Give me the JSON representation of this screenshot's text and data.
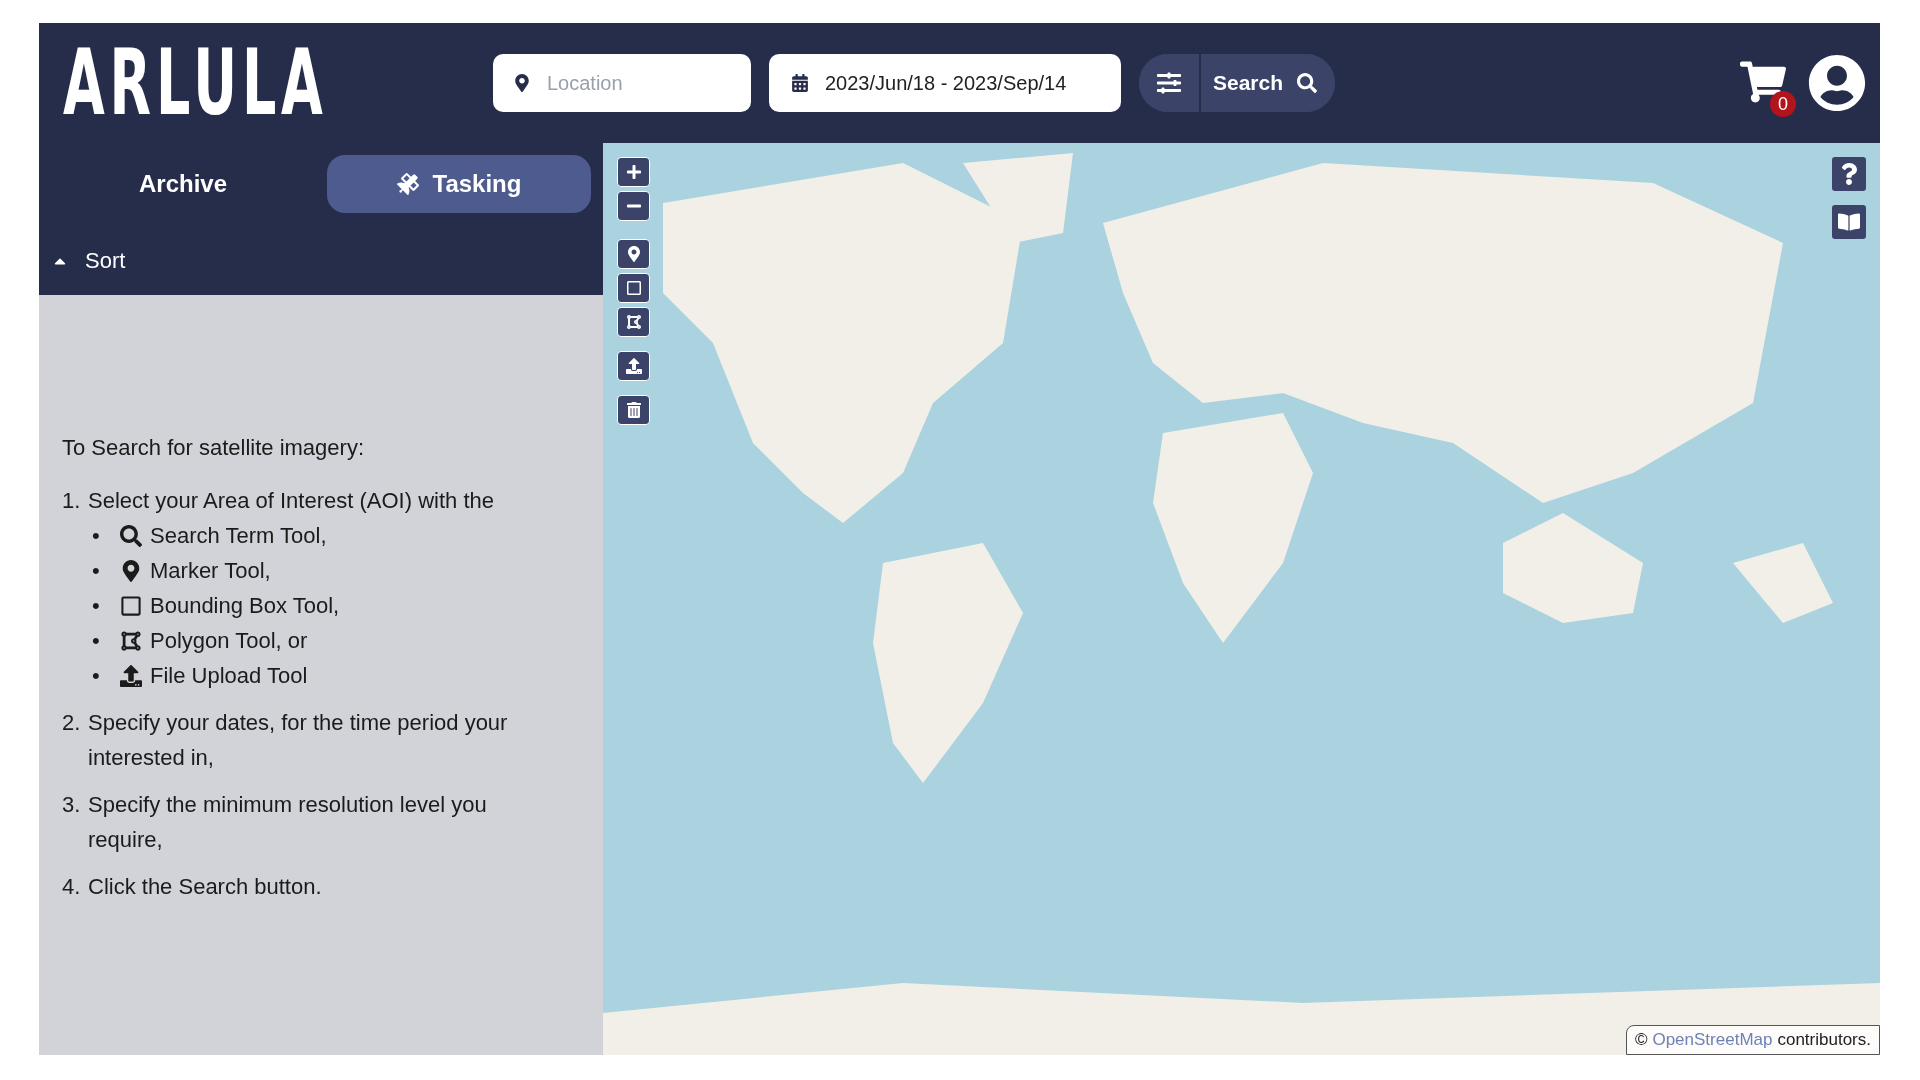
{
  "header": {
    "logo": "ARLULA",
    "location": {
      "placeholder": "Location"
    },
    "date_range": "2023/Jun/18 - 2023/Sep/14",
    "search_button": "Search",
    "cart_count": "0"
  },
  "tabs": [
    {
      "label": "Archive",
      "selected": false
    },
    {
      "label": "Tasking",
      "selected": true
    }
  ],
  "sort": {
    "label": "Sort"
  },
  "instructions": {
    "intro": "To Search for satellite imagery:",
    "steps": [
      {
        "number": "1.",
        "text": "Select your Area of Interest (AOI) with the",
        "tools": [
          {
            "bullet": "•",
            "kind": "search",
            "label": "Search Term Tool,"
          },
          {
            "bullet": "•",
            "kind": "marker",
            "label": "Marker Tool,"
          },
          {
            "bullet": "•",
            "kind": "box",
            "label": "Bounding Box Tool,"
          },
          {
            "bullet": "•",
            "kind": "polygon",
            "label": "Polygon Tool, or"
          },
          {
            "bullet": "•",
            "kind": "upload",
            "label": "File Upload Tool"
          }
        ]
      },
      {
        "number": "2.",
        "text": "Specify your dates, for the time period your interested in,"
      },
      {
        "number": "3.",
        "text": "Specify the minimum resolution level you require,"
      },
      {
        "number": "4.",
        "text": "Click the Search button."
      }
    ]
  },
  "map_tools": [
    {
      "kind": "zoom_in"
    },
    {
      "kind": "zoom_out"
    },
    {
      "kind": "marker"
    },
    {
      "kind": "box"
    },
    {
      "kind": "polygon"
    },
    {
      "kind": "upload"
    },
    {
      "kind": "delete"
    }
  ],
  "map_side_tools": [
    {
      "kind": "help"
    },
    {
      "kind": "guide"
    }
  ],
  "attribution": {
    "symbol": "©",
    "link": "OpenStreetMap",
    "text": "contributors."
  }
}
